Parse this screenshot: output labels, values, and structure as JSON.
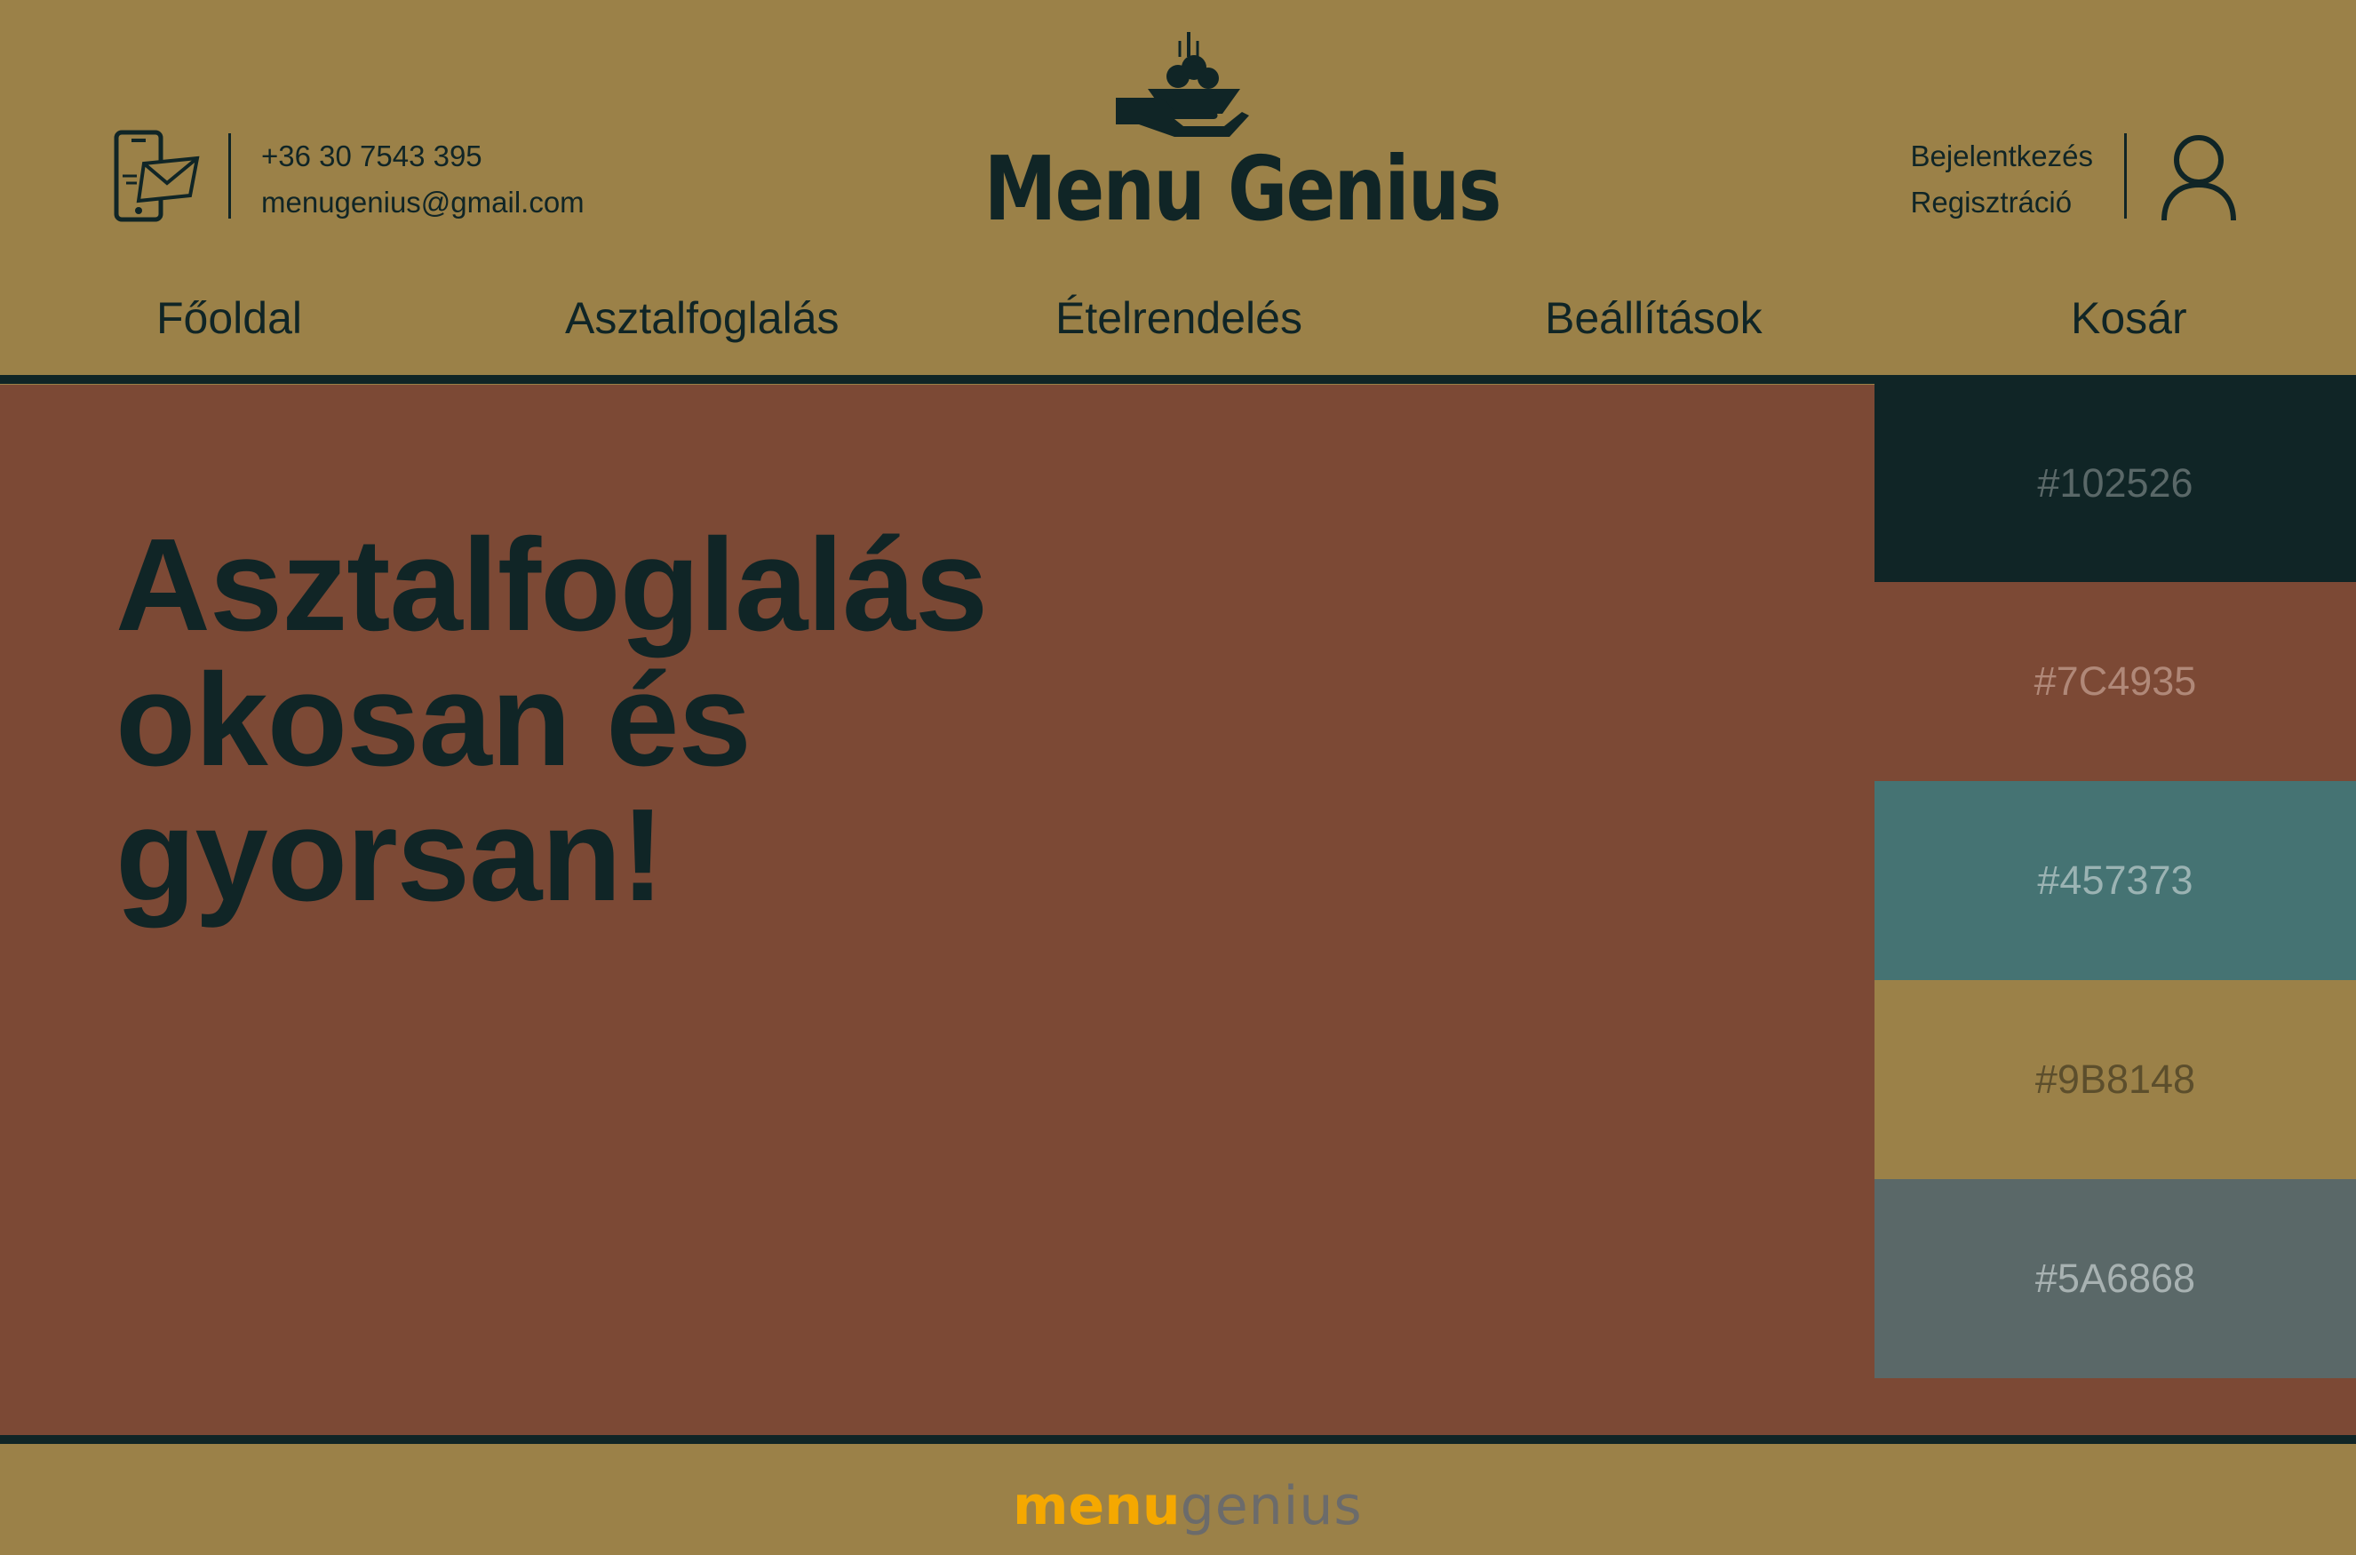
{
  "colors": {
    "dark": "#102526",
    "brown": "#7C4935",
    "teal": "#457373",
    "gold": "#9B8148",
    "slate": "#5A6868",
    "footer_menu": "#F5A800",
    "footer_genius": "#6B6B6B"
  },
  "header": {
    "contact_icon": "phone-mail-icon",
    "phone": "+36 30 7543 395",
    "email": "menugenius@gmail.com",
    "logo_icon": "serving-hand-dish-icon",
    "logo_text": "Menu Genius",
    "login": "Bejelentkezés",
    "register": "Regisztráció",
    "user_icon": "user-icon"
  },
  "nav": [
    {
      "label": "Főoldal"
    },
    {
      "label": "Asztalfoglalás"
    },
    {
      "label": "Ételrendelés"
    },
    {
      "label": "Beállítások"
    },
    {
      "label": "Kosár"
    }
  ],
  "hero": {
    "lines": [
      "Asztalfoglalás",
      "okosan és",
      "gyorsan!"
    ]
  },
  "palette": [
    {
      "label": "#102526",
      "bg": "#102526",
      "text": "#5A6868"
    },
    {
      "label": "#7C4935",
      "bg": "#7C4935",
      "text": "#B08878"
    },
    {
      "label": "#457373",
      "bg": "#457373",
      "text": "#9BB3B3"
    },
    {
      "label": "#9B8148",
      "bg": "#9B8148",
      "text": "#5C4E2C"
    },
    {
      "label": "#5A6868",
      "bg": "#5A6868",
      "text": "#A8B2B2"
    }
  ],
  "footer": {
    "logo_part1": "menu",
    "logo_part2": "genius"
  }
}
